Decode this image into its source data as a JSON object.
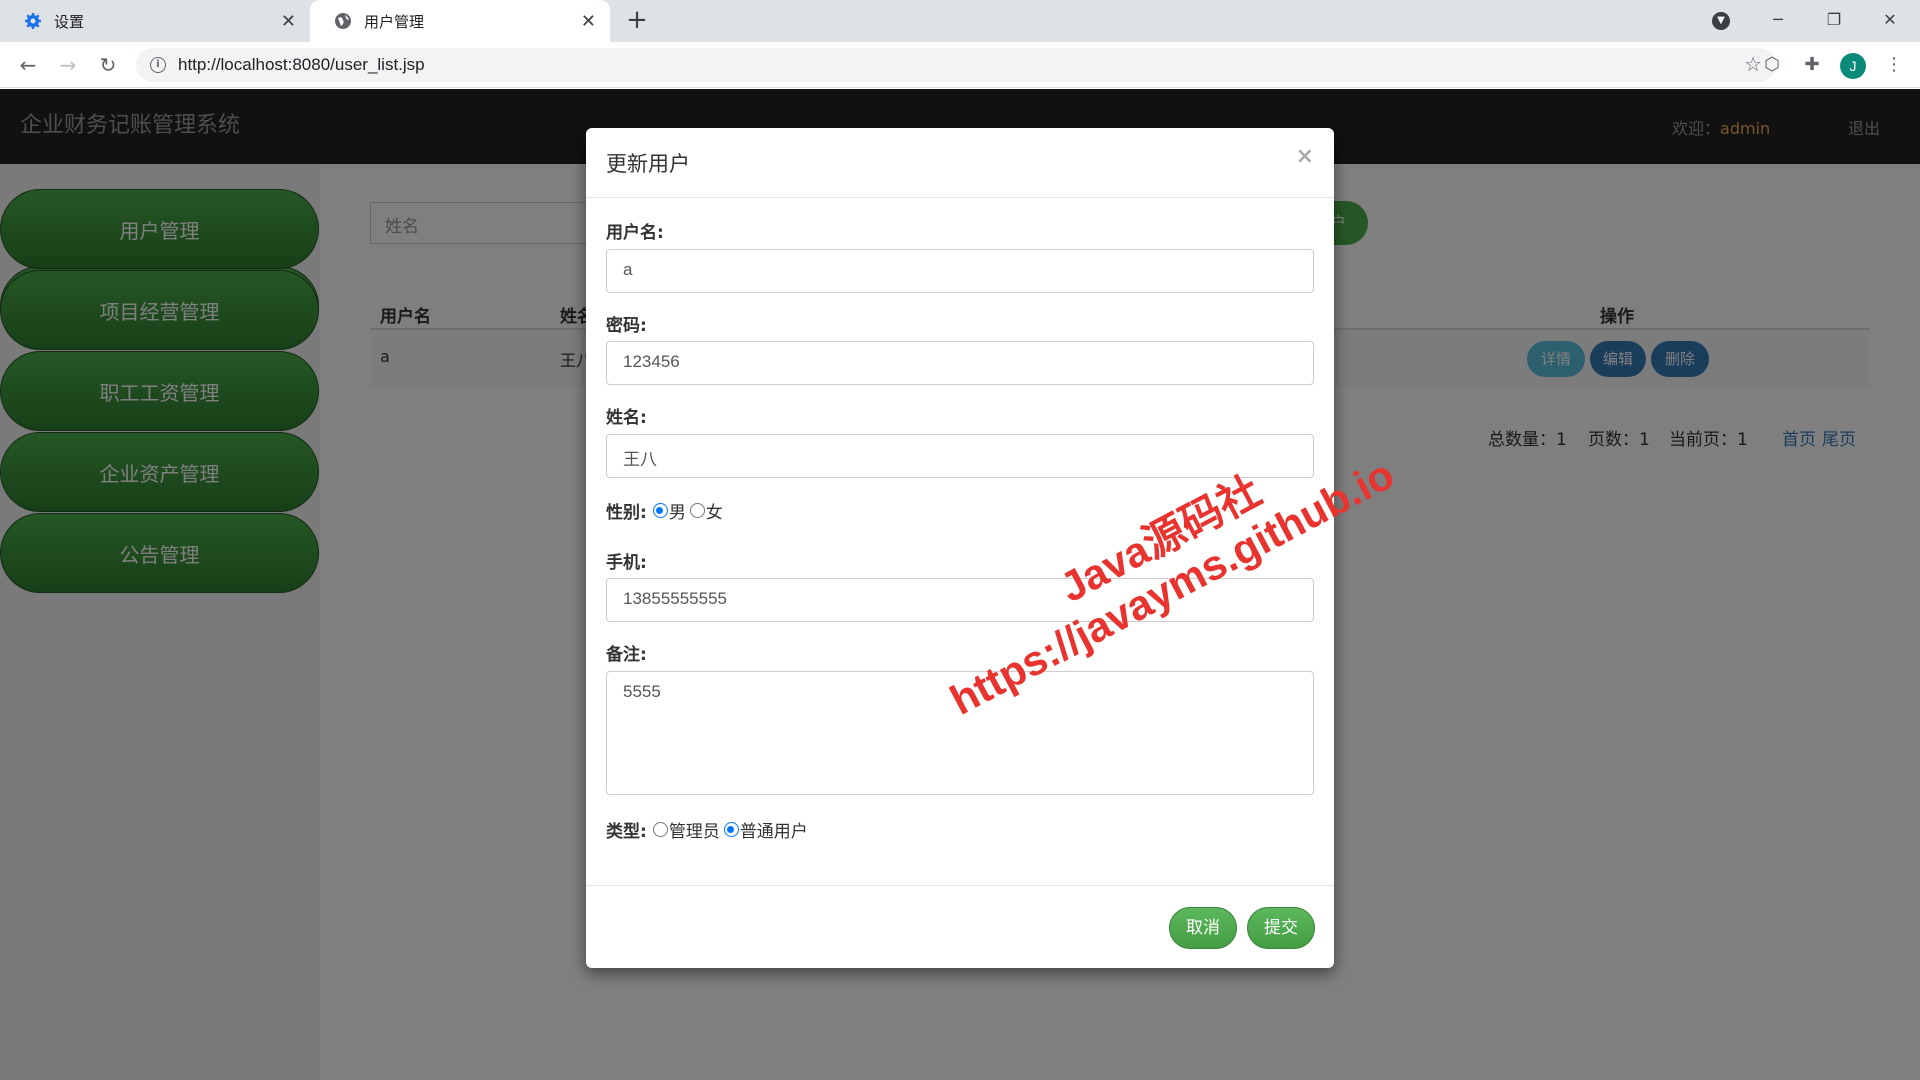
{
  "browser": {
    "tabs": [
      {
        "title": "设置",
        "icon": "gear-icon"
      },
      {
        "title": "用户管理",
        "icon": "globe-icon"
      }
    ],
    "url": "http://localhost:8080/user_list.jsp",
    "avatar_letter": "J"
  },
  "app": {
    "title": "企业财务记账管理系统",
    "welcome_label": "欢迎：",
    "username": "admin",
    "logout": "退出"
  },
  "sidebar": {
    "items": [
      {
        "label": "用户管理"
      },
      {
        "label": "项目经营管理"
      },
      {
        "label": "职工工资管理"
      },
      {
        "label": "企业资产管理"
      },
      {
        "label": "公告管理"
      }
    ]
  },
  "list": {
    "search_placeholder": "姓名",
    "add_button_partial": "户",
    "columns": {
      "username": "用户名",
      "name_partial": "姓名",
      "actions": "操作"
    },
    "rows": [
      {
        "username": "a",
        "name_partial": "王八"
      }
    ],
    "row_actions": {
      "detail": "详情",
      "edit": "编辑",
      "delete": "删除"
    },
    "pager": {
      "total": "总数量：1",
      "pages": "页数：1",
      "current": "当前页：1",
      "first": "首页",
      "last": "尾页"
    }
  },
  "modal": {
    "title": "更新用户",
    "close_symbol": "×",
    "fields": {
      "username_label": "用户名:",
      "username_value": "a",
      "password_label": "密码:",
      "password_value": "123456",
      "name_label": "姓名:",
      "name_value": "王八",
      "gender_label": "性别:",
      "gender_options": [
        "男",
        "女"
      ],
      "gender_selected": "男",
      "phone_label": "手机:",
      "phone_value": "13855555555",
      "remark_label": "备注:",
      "remark_value": "5555",
      "type_label": "类型:",
      "type_options": [
        "管理员",
        "普通用户"
      ],
      "type_selected": "普通用户"
    },
    "buttons": {
      "cancel": "取消",
      "submit": "提交"
    }
  },
  "watermark": {
    "line1": "Java源码社",
    "line2": "https://javayms.github.io"
  },
  "colors": {
    "header_bg": "#222222",
    "sidebar_button": "#4cae4c",
    "username_accent": "#f0ad4e",
    "watermark": "#e8332f"
  }
}
